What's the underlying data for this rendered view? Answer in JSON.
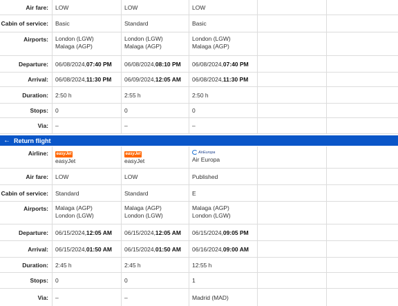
{
  "outbound": {
    "air_fare": {
      "label": "Air fare:",
      "values": [
        "LOW",
        "LOW",
        "LOW"
      ]
    },
    "cabin": {
      "label": "Cabin of service:",
      "values": [
        "Basic",
        "Standard",
        "Basic"
      ]
    },
    "airports": {
      "label": "Airports:",
      "values": [
        [
          "London (LGW)",
          "Malaga (AGP)"
        ],
        [
          "London (LGW)",
          "Malaga (AGP)"
        ],
        [
          "London (LGW)",
          "Malaga (AGP)"
        ]
      ]
    },
    "departure": {
      "label": "Departure:",
      "values": [
        {
          "date": "06/08/2024, ",
          "time": "07:40 PM"
        },
        {
          "date": "06/08/2024, ",
          "time": "08:10 PM"
        },
        {
          "date": "06/08/2024, ",
          "time": "07:40 PM"
        }
      ]
    },
    "arrival": {
      "label": "Arrival:",
      "values": [
        {
          "date": "06/08/2024, ",
          "time": "11:30 PM"
        },
        {
          "date": "06/09/2024, ",
          "time": "12:05 AM"
        },
        {
          "date": "06/08/2024, ",
          "time": "11:30 PM"
        }
      ]
    },
    "duration": {
      "label": "Duration:",
      "values": [
        "2:50 h",
        "2:55 h",
        "2:50 h"
      ]
    },
    "stops": {
      "label": "Stops:",
      "values": [
        "0",
        "0",
        "0"
      ]
    },
    "via": {
      "label": "Via:",
      "values": [
        "–",
        "–",
        "–"
      ]
    }
  },
  "return_header": {
    "icon": "arrow-left-icon",
    "arrow": "←",
    "label": "Return flight",
    "color": "#0a56c8"
  },
  "return": {
    "airline": {
      "label": "Airline:",
      "values": [
        {
          "name": "easyJet",
          "logo": "easyJet",
          "logo_icon": "easyjet-logo-icon"
        },
        {
          "name": "easyJet",
          "logo": "easyJet",
          "logo_icon": "easyjet-logo-icon"
        },
        {
          "name": "Air Europa",
          "logo": "AirEuropa",
          "logo_icon": "air-europa-logo-icon"
        }
      ]
    },
    "air_fare": {
      "label": "Air fare:",
      "values": [
        "LOW",
        "LOW",
        "Published"
      ]
    },
    "cabin": {
      "label": "Cabin of service:",
      "values": [
        "Standard",
        "Standard",
        "E"
      ]
    },
    "airports": {
      "label": "Airports:",
      "values": [
        [
          "Malaga (AGP)",
          "London (LGW)"
        ],
        [
          "Malaga (AGP)",
          "London (LGW)"
        ],
        [
          "Malaga (AGP)",
          "London (LGW)"
        ]
      ]
    },
    "departure": {
      "label": "Departure:",
      "values": [
        {
          "date": "06/15/2024, ",
          "time": "12:05 AM"
        },
        {
          "date": "06/15/2024, ",
          "time": "12:05 AM"
        },
        {
          "date": "06/15/2024, ",
          "time": "09:05 PM"
        }
      ]
    },
    "arrival": {
      "label": "Arrival:",
      "values": [
        {
          "date": "06/15/2024, ",
          "time": "01:50 AM"
        },
        {
          "date": "06/15/2024, ",
          "time": "01:50 AM"
        },
        {
          "date": "06/16/2024, ",
          "time": "09:00 AM"
        }
      ]
    },
    "duration": {
      "label": "Duration:",
      "values": [
        "2:45 h",
        "2:45 h",
        "12:55 h"
      ]
    },
    "stops": {
      "label": "Stops:",
      "values": [
        "0",
        "0",
        "1"
      ]
    },
    "via": {
      "label": "Via:",
      "values": [
        "–",
        "–",
        "Madrid (MAD)"
      ]
    }
  },
  "colors": {
    "accent": "#0a56c8",
    "easyjet": "#ff6600",
    "grid": "#dcdcdc"
  }
}
